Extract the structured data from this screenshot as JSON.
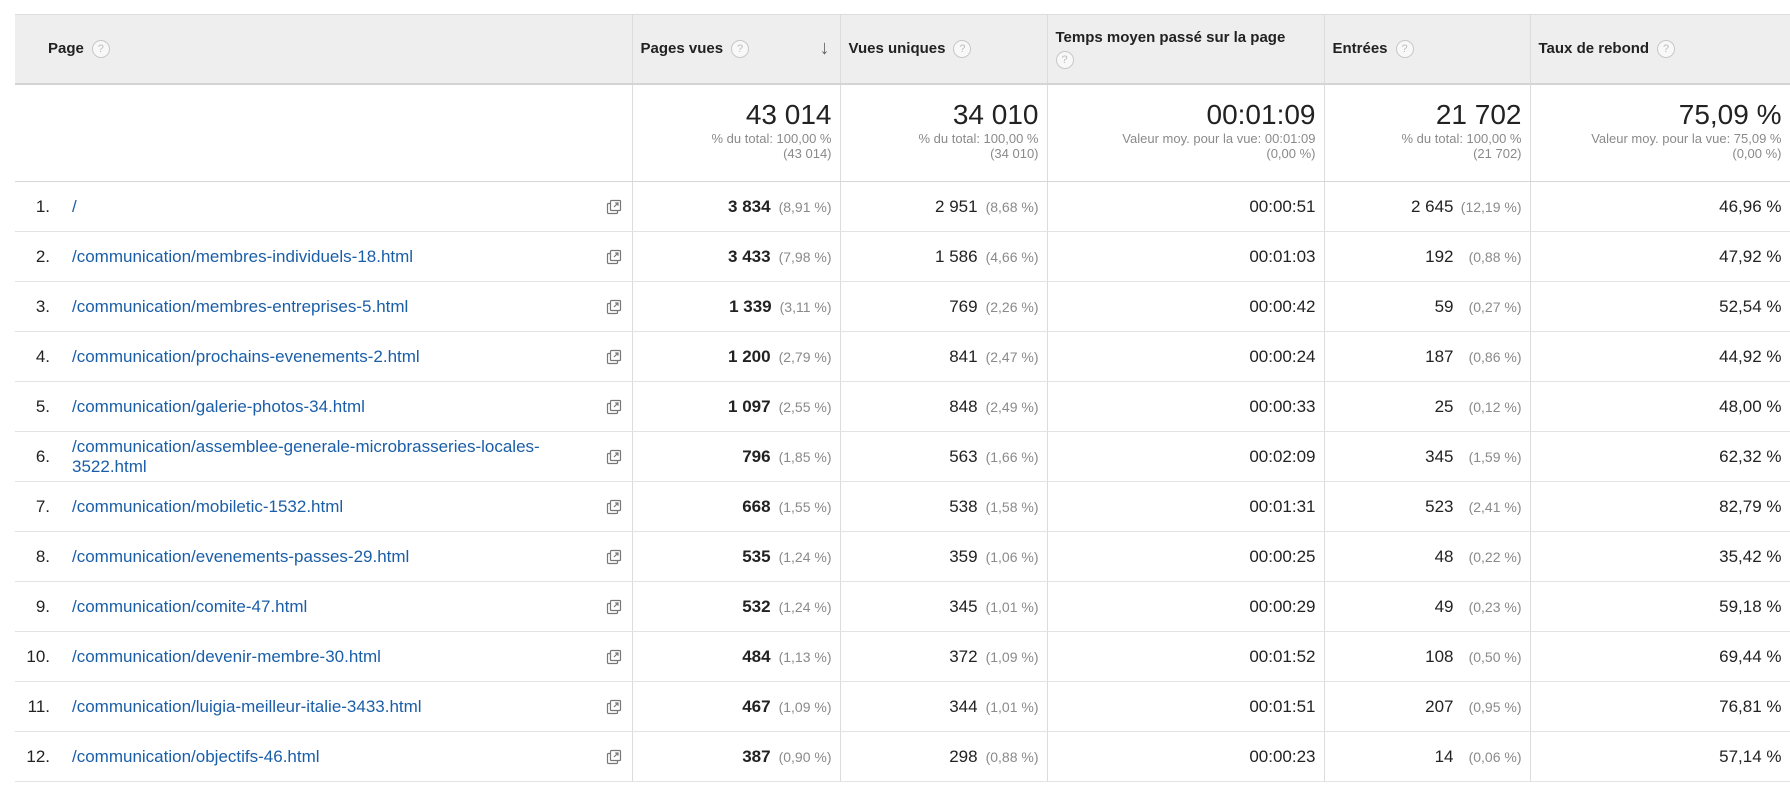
{
  "columns": {
    "page": "Page",
    "pageviews": "Pages vues",
    "unique": "Vues uniques",
    "time": "Temps moyen passé sur la page",
    "entries": "Entrées",
    "bounce": "Taux de rebond"
  },
  "sort_arrow": "↓",
  "help_glyph": "?",
  "totals": {
    "pageviews": {
      "value": "43 014",
      "line1": "% du total: 100,00 %",
      "line2": "(43 014)"
    },
    "unique": {
      "value": "34 010",
      "line1": "% du total: 100,00 %",
      "line2": "(34 010)"
    },
    "time": {
      "value": "00:01:09",
      "line1": "Valeur moy. pour la vue: 00:01:09",
      "line2": "(0,00 %)"
    },
    "entries": {
      "value": "21 702",
      "line1": "% du total: 100,00 %",
      "line2": "(21 702)"
    },
    "bounce": {
      "value": "75,09 %",
      "line1": "Valeur moy. pour la vue: 75,09 %",
      "line2": "(0,00 %)"
    }
  },
  "rows": [
    {
      "idx": "1.",
      "page": "/",
      "pv": "3 834",
      "pv_pct": "(8,91 %)",
      "uv": "2 951",
      "uv_pct": "(8,68 %)",
      "time": "00:00:51",
      "ent": "2 645",
      "ent_pct": "(12,19 %)",
      "bounce": "46,96 %"
    },
    {
      "idx": "2.",
      "page": "/communication/membres-individuels-18.html",
      "pv": "3 433",
      "pv_pct": "(7,98 %)",
      "uv": "1 586",
      "uv_pct": "(4,66 %)",
      "time": "00:01:03",
      "ent": "192",
      "ent_pct": "(0,88 %)",
      "bounce": "47,92 %"
    },
    {
      "idx": "3.",
      "page": "/communication/membres-entreprises-5.html",
      "pv": "1 339",
      "pv_pct": "(3,11 %)",
      "uv": "769",
      "uv_pct": "(2,26 %)",
      "time": "00:00:42",
      "ent": "59",
      "ent_pct": "(0,27 %)",
      "bounce": "52,54 %"
    },
    {
      "idx": "4.",
      "page": "/communication/prochains-evenements-2.html",
      "pv": "1 200",
      "pv_pct": "(2,79 %)",
      "uv": "841",
      "uv_pct": "(2,47 %)",
      "time": "00:00:24",
      "ent": "187",
      "ent_pct": "(0,86 %)",
      "bounce": "44,92 %"
    },
    {
      "idx": "5.",
      "page": "/communication/galerie-photos-34.html",
      "pv": "1 097",
      "pv_pct": "(2,55 %)",
      "uv": "848",
      "uv_pct": "(2,49 %)",
      "time": "00:00:33",
      "ent": "25",
      "ent_pct": "(0,12 %)",
      "bounce": "48,00 %"
    },
    {
      "idx": "6.",
      "page": "/communication/assemblee-generale-microbrasseries-locales-3522.html",
      "pv": "796",
      "pv_pct": "(1,85 %)",
      "uv": "563",
      "uv_pct": "(1,66 %)",
      "time": "00:02:09",
      "ent": "345",
      "ent_pct": "(1,59 %)",
      "bounce": "62,32 %"
    },
    {
      "idx": "7.",
      "page": "/communication/mobiletic-1532.html",
      "pv": "668",
      "pv_pct": "(1,55 %)",
      "uv": "538",
      "uv_pct": "(1,58 %)",
      "time": "00:01:31",
      "ent": "523",
      "ent_pct": "(2,41 %)",
      "bounce": "82,79 %"
    },
    {
      "idx": "8.",
      "page": "/communication/evenements-passes-29.html",
      "pv": "535",
      "pv_pct": "(1,24 %)",
      "uv": "359",
      "uv_pct": "(1,06 %)",
      "time": "00:00:25",
      "ent": "48",
      "ent_pct": "(0,22 %)",
      "bounce": "35,42 %"
    },
    {
      "idx": "9.",
      "page": "/communication/comite-47.html",
      "pv": "532",
      "pv_pct": "(1,24 %)",
      "uv": "345",
      "uv_pct": "(1,01 %)",
      "time": "00:00:29",
      "ent": "49",
      "ent_pct": "(0,23 %)",
      "bounce": "59,18 %"
    },
    {
      "idx": "10.",
      "page": "/communication/devenir-membre-30.html",
      "pv": "484",
      "pv_pct": "(1,13 %)",
      "uv": "372",
      "uv_pct": "(1,09 %)",
      "time": "00:01:52",
      "ent": "108",
      "ent_pct": "(0,50 %)",
      "bounce": "69,44 %"
    },
    {
      "idx": "11.",
      "page": "/communication/luigia-meilleur-italie-3433.html",
      "pv": "467",
      "pv_pct": "(1,09 %)",
      "uv": "344",
      "uv_pct": "(1,01 %)",
      "time": "00:01:51",
      "ent": "207",
      "ent_pct": "(0,95 %)",
      "bounce": "76,81 %"
    },
    {
      "idx": "12.",
      "page": "/communication/objectifs-46.html",
      "pv": "387",
      "pv_pct": "(0,90 %)",
      "uv": "298",
      "uv_pct": "(0,88 %)",
      "time": "00:00:23",
      "ent": "14",
      "ent_pct": "(0,06 %)",
      "bounce": "57,14 %"
    }
  ],
  "colors": {
    "link": "#1a5ea8",
    "header_bg": "#eeeeee",
    "muted": "#8a8a8a"
  }
}
